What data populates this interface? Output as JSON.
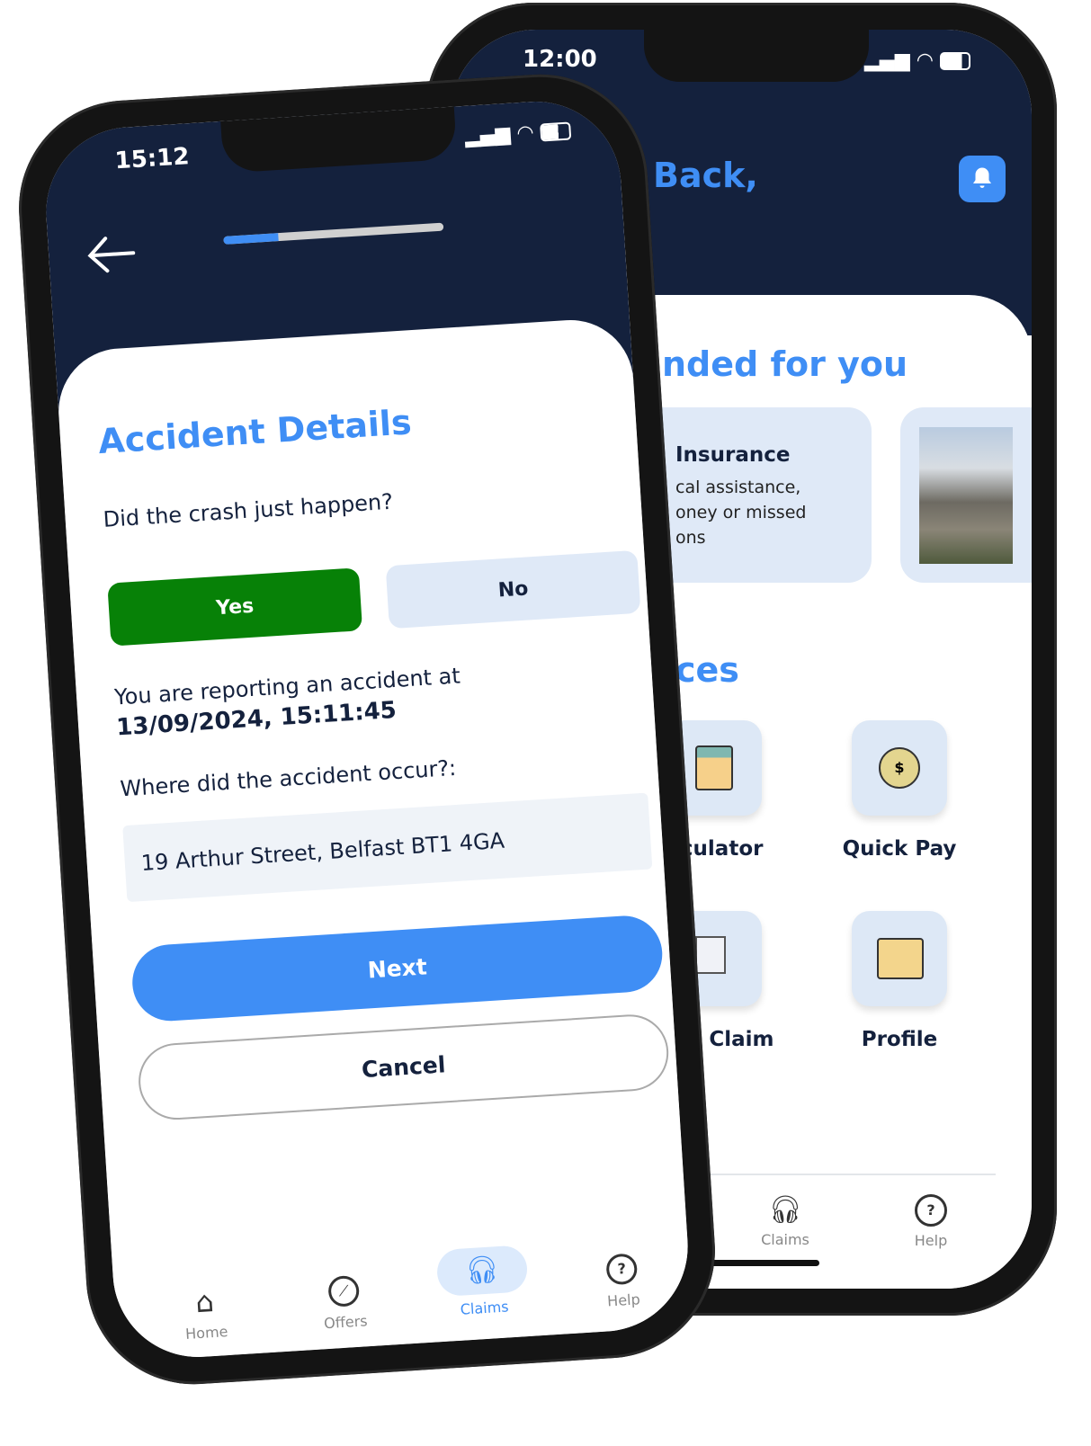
{
  "back_phone": {
    "status_time": "12:00",
    "greeting": "Back,",
    "section_recommended": "nded for you",
    "card": {
      "title": "Insurance",
      "lines": [
        "cal assistance,",
        "oney or missed",
        "ons"
      ]
    },
    "section_services": "ces",
    "services": [
      {
        "label": "alculator",
        "icon": "calculator-icon"
      },
      {
        "label": "Quick Pay",
        "icon": "stopwatch-dollar-icon"
      },
      {
        "label": "ck Claim",
        "icon": "clipboard-icon"
      },
      {
        "label": "Profile",
        "icon": "profile-card-icon"
      }
    ],
    "tabs": [
      {
        "label": "Claims",
        "icon": "headset-icon"
      },
      {
        "label": "Help",
        "icon": "help-icon"
      }
    ]
  },
  "front_phone": {
    "status_time": "15:12",
    "progress_percent": 25,
    "title": "Accident Details",
    "question": "Did the crash just happen?",
    "yes_label": "Yes",
    "no_label": "No",
    "report_prefix": "You are reporting an accident at ",
    "report_datetime": "13/09/2024, 15:11:45",
    "location_label": "Where did the accident occur?:",
    "location_value": "19 Arthur Street, Belfast BT1 4GA",
    "next_label": "Next",
    "cancel_label": "Cancel",
    "tabs": [
      {
        "label": "Home",
        "icon": "home-icon"
      },
      {
        "label": "Offers",
        "icon": "compass-icon"
      },
      {
        "label": "Claims",
        "icon": "headset-icon"
      },
      {
        "label": "Help",
        "icon": "help-icon"
      }
    ]
  },
  "colors": {
    "navy": "#14213d",
    "accent": "#3f8ef5",
    "yes_green": "#078107",
    "no_bg": "#dfe9f7",
    "title_blue": "#3f8ef5"
  }
}
